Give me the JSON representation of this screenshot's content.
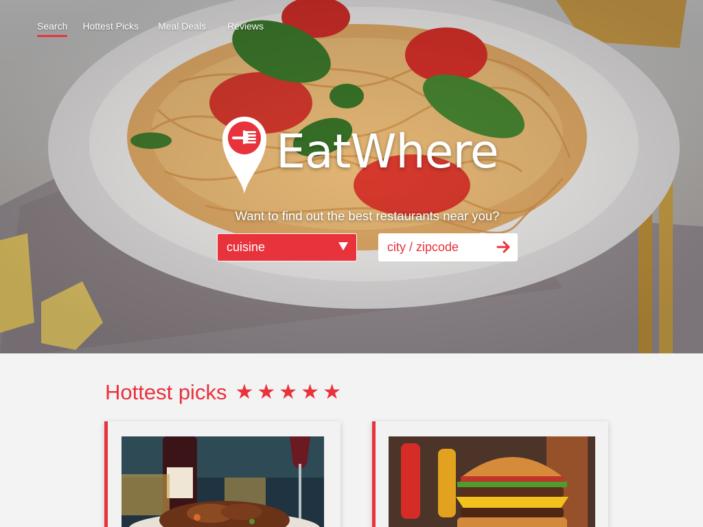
{
  "nav": {
    "items": [
      {
        "label": "Search",
        "active": true
      },
      {
        "label": "Hottest Picks",
        "active": false
      },
      {
        "label": "Meal Deals",
        "active": false
      },
      {
        "label": "Reviews",
        "active": false
      }
    ]
  },
  "brand": {
    "name": "EatWhere"
  },
  "hero": {
    "tagline": "Want to find out the best restaurants near you?",
    "cuisine_select": {
      "value": "cuisine"
    },
    "location_input": {
      "placeholder": "city / zipcode"
    }
  },
  "picks": {
    "title": "Hottest picks",
    "rating": 5,
    "stars": [
      "★",
      "★",
      "★",
      "★",
      "★"
    ]
  },
  "colors": {
    "accent": "#e8323c",
    "background": "#f3f3f3"
  },
  "icons": {
    "pin": "map-pin-fork-icon",
    "go": "arrow-right-icon",
    "caret": "caret-down-icon",
    "star": "star-icon"
  }
}
